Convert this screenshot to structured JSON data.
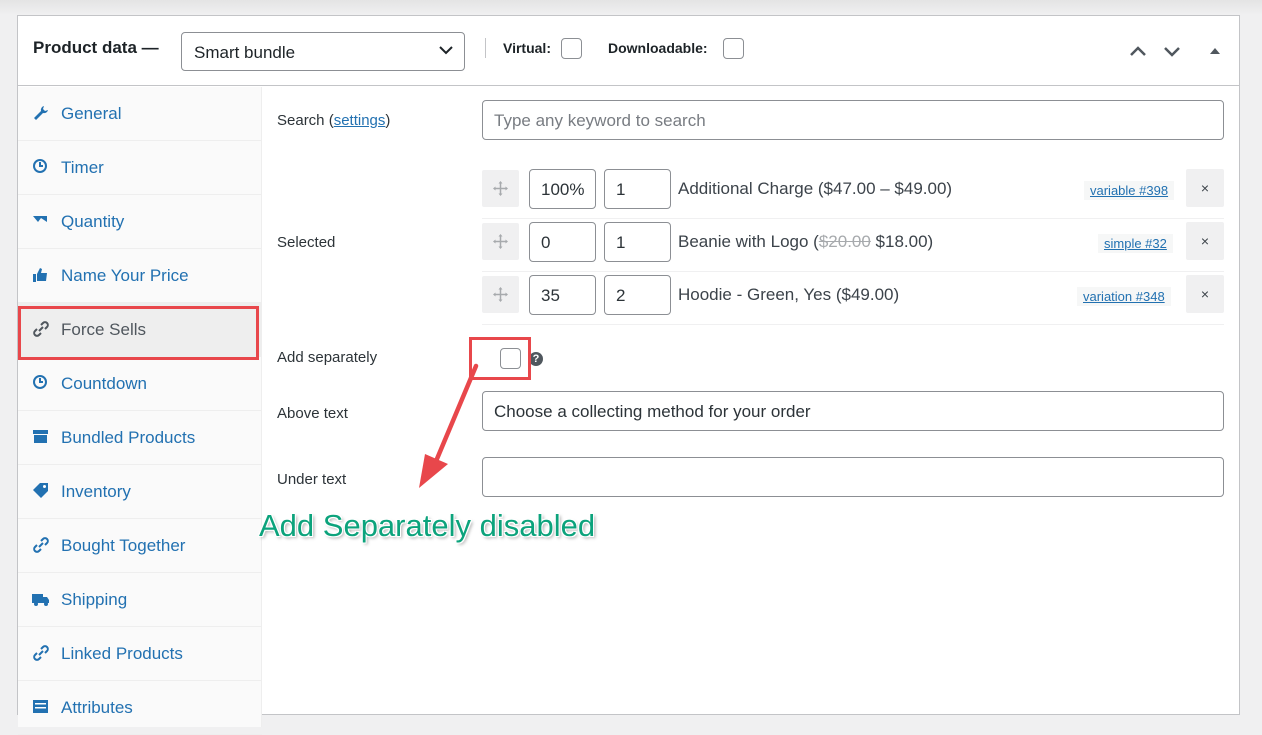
{
  "header": {
    "title": "Product data —",
    "product_type": "Smart bundle",
    "virtual_label": "Virtual:",
    "downloadable_label": "Downloadable:"
  },
  "sidebar": {
    "items": [
      {
        "label": "General",
        "icon": "wrench-icon"
      },
      {
        "label": "Timer",
        "icon": "clock-icon"
      },
      {
        "label": "Quantity",
        "icon": "chart-icon"
      },
      {
        "label": "Name Your Price",
        "icon": "thumbs-up-icon"
      },
      {
        "label": "Force Sells",
        "icon": "link-icon"
      },
      {
        "label": "Countdown",
        "icon": "clock-icon"
      },
      {
        "label": "Bundled Products",
        "icon": "archive-icon"
      },
      {
        "label": "Inventory",
        "icon": "tag-icon"
      },
      {
        "label": "Bought Together",
        "icon": "link-icon"
      },
      {
        "label": "Shipping",
        "icon": "truck-icon"
      },
      {
        "label": "Linked Products",
        "icon": "link-icon"
      },
      {
        "label": "Attributes",
        "icon": "list-icon"
      }
    ]
  },
  "form": {
    "search_label": "Search (",
    "search_link": "settings",
    "search_label_end": ")",
    "search_placeholder": "Type any keyword to search",
    "selected_label": "Selected",
    "products": [
      {
        "discount": "100%",
        "qty": "1",
        "name": "Additional Charge ($47.00 – $49.00)",
        "old_price": "",
        "new_price": "",
        "type": "variable #398"
      },
      {
        "discount": "0",
        "qty": "1",
        "name": "Beanie with Logo (",
        "old_price": "$20.00",
        "new_price": " $18.00)",
        "type": "simple #32"
      },
      {
        "discount": "35",
        "qty": "2",
        "name": "Hoodie - Green, Yes ($49.00)",
        "old_price": "",
        "new_price": "",
        "type": "variation #348"
      }
    ],
    "remove_glyph": "×",
    "add_separately_label": "Add separately",
    "help_glyph": "?",
    "above_text_label": "Above text",
    "above_text_value": "Choose a collecting method for your order",
    "under_text_label": "Under text",
    "under_text_value": ""
  },
  "annotation": {
    "text": "Add Separately disabled",
    "color": "#0ca37c",
    "highlight_color": "#e8474b"
  }
}
